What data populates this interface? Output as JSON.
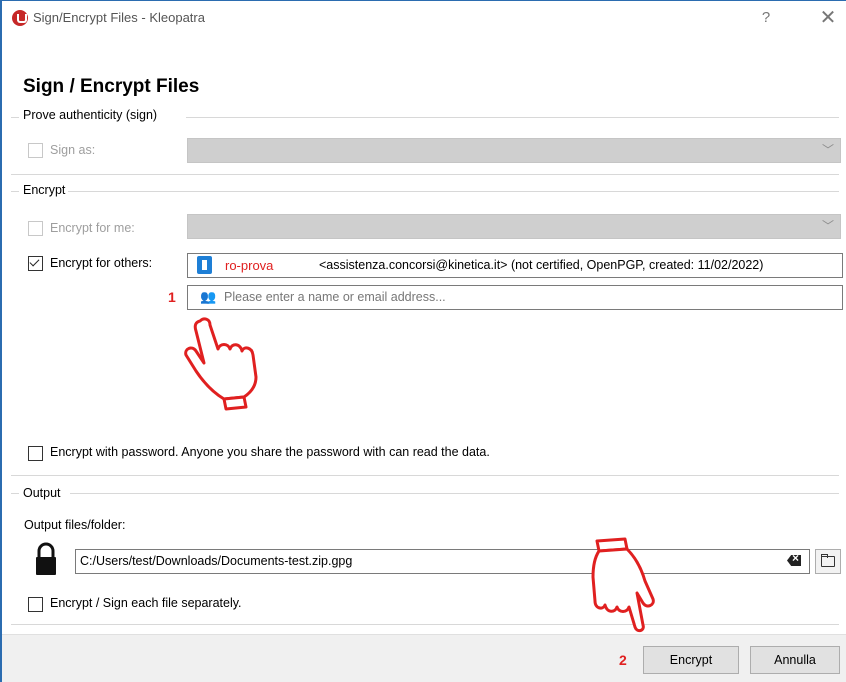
{
  "window": {
    "title": "Sign/Encrypt Files - Kleopatra",
    "help_label": "?",
    "close_label": "✕"
  },
  "heading": "Sign / Encrypt Files",
  "sign_group": {
    "label": "Prove authenticity (sign)",
    "sign_as_label": "Sign as:",
    "sign_as_checked": false,
    "sign_as_value": ""
  },
  "encrypt_group": {
    "label": "Encrypt",
    "encrypt_for_me_label": "Encrypt for me:",
    "encrypt_for_me_checked": false,
    "encrypt_for_others_label": "Encrypt for others:",
    "encrypt_for_others_checked": true,
    "recipient": {
      "name": "ro-prova",
      "details": "<assistenza.concorsi@kinetica.it> (not certified, OpenPGP, created: 11/02/2022)"
    },
    "recipient_placeholder": "Please enter a name or email address...",
    "password_label": "Encrypt with password. Anyone you share the password with can read the data.",
    "password_checked": false
  },
  "output_group": {
    "label": "Output",
    "files_folder_label": "Output files/folder:",
    "path_value": "C:/Users/test/Downloads/Documents-test.zip.gpg",
    "separately_label": "Encrypt / Sign each file separately.",
    "separately_checked": false
  },
  "annotations": {
    "step1": "1",
    "step2": "2"
  },
  "buttons": {
    "encrypt": "Encrypt",
    "cancel": "Annulla"
  },
  "colors": {
    "annotation": "#e02020",
    "window_border": "#2b6cb0",
    "cert_icon": "#1e7fd6"
  }
}
